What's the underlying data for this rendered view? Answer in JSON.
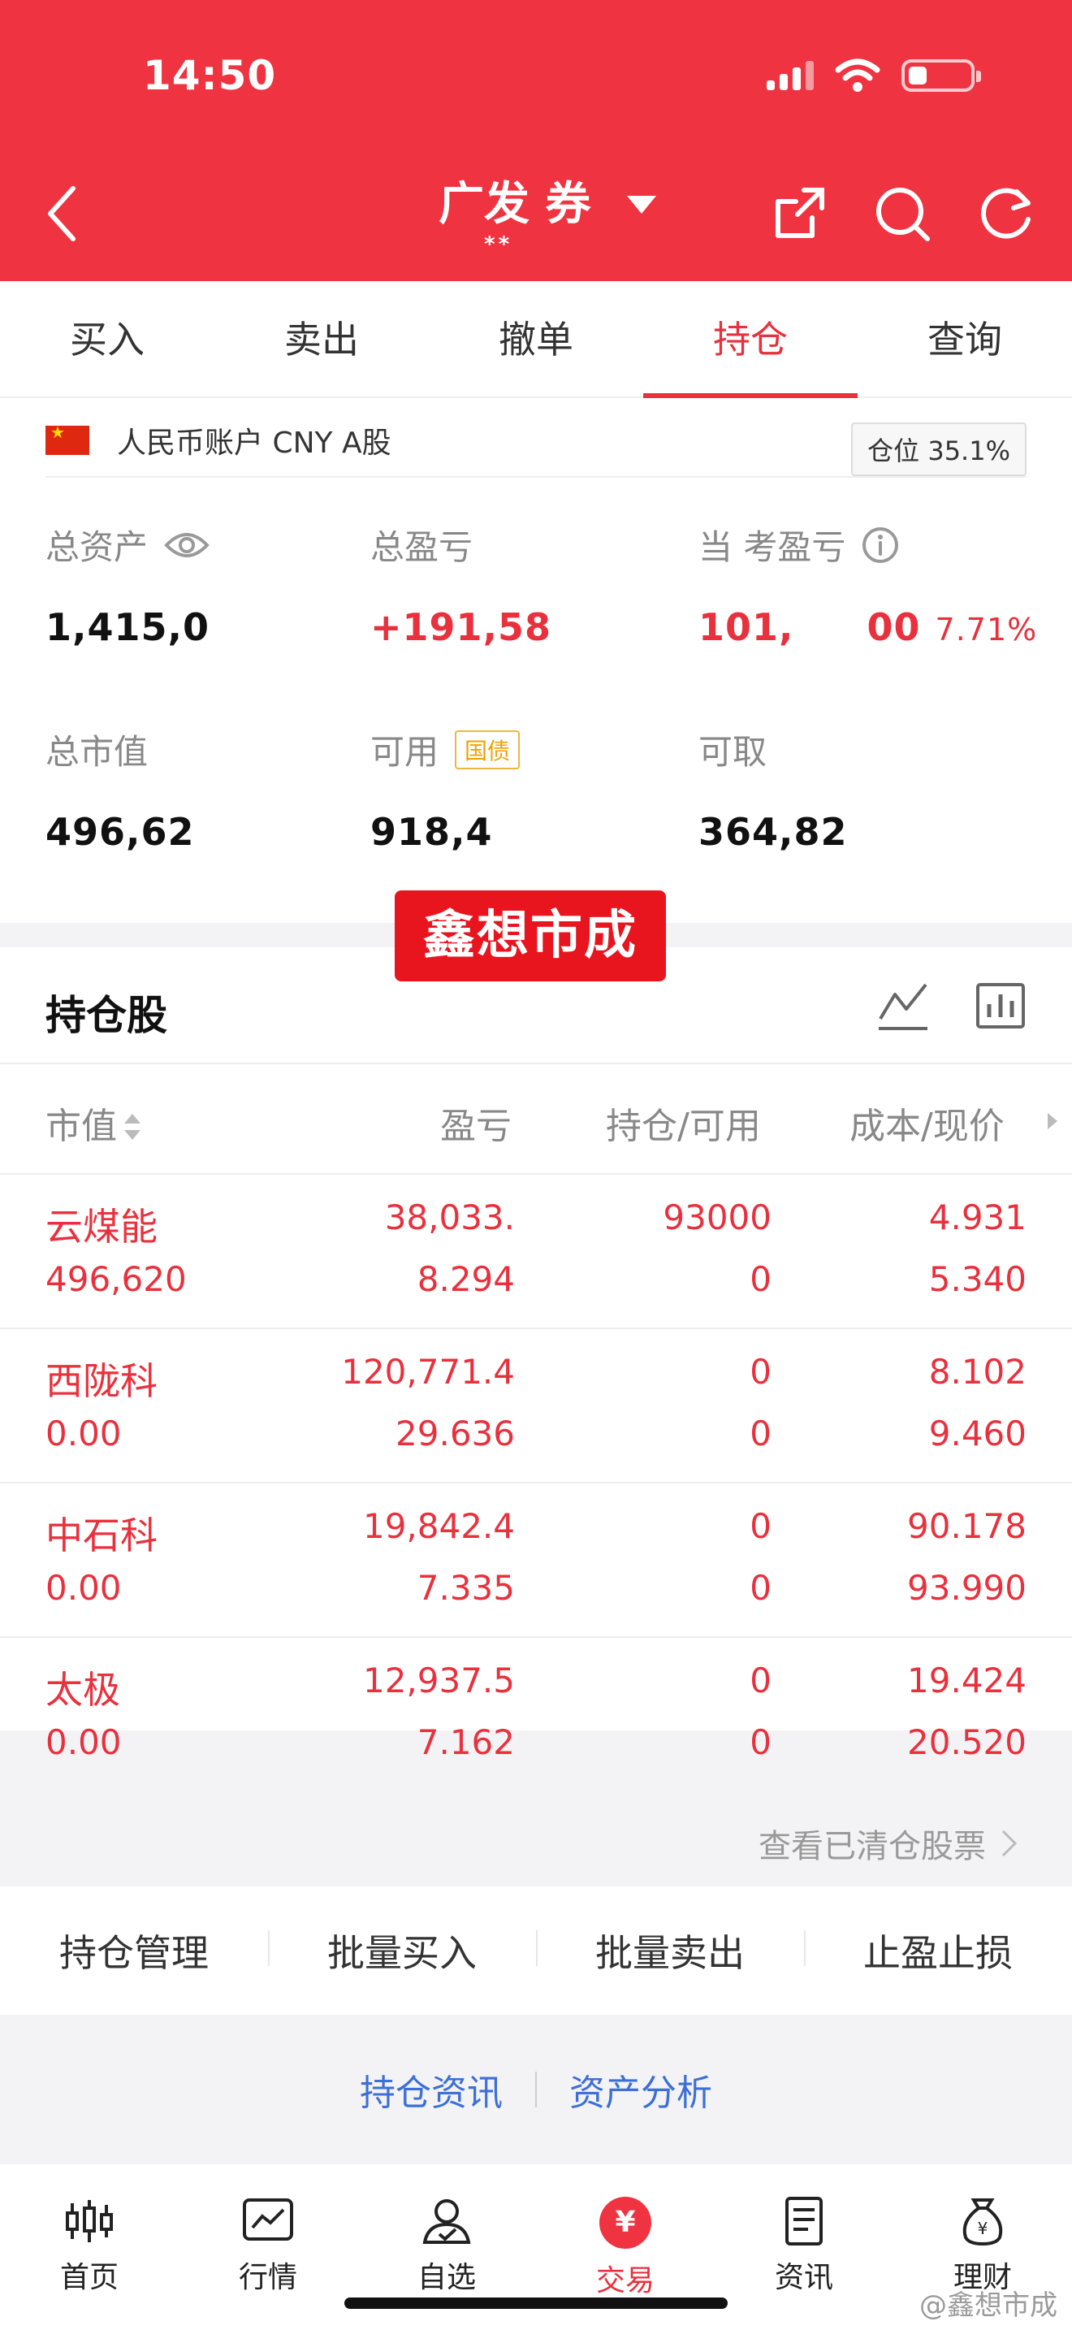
{
  "status": {
    "time": "14:50"
  },
  "nav": {
    "title": "广发 券",
    "subtitle": "**"
  },
  "tabs": [
    "买入",
    "卖出",
    "撤单",
    "持仓",
    "查询"
  ],
  "account": {
    "currency_label": "人民币账户 CNY A股",
    "position_ratio": "仓位 35.1%",
    "total_assets_label": "总资产",
    "total_assets": "1,415,0",
    "total_pl_label": "总盈亏",
    "total_pl": "+191,58",
    "daily_pl_label": "当 考盈亏",
    "daily_pl": "101,",
    "daily_pl_tail": "00",
    "daily_pl_pct": "7.71%",
    "market_value_label": "总市值",
    "market_value": "496,62",
    "available_label": "可用",
    "available_tag": "国债",
    "available": "918,4",
    "withdrawable_label": "可取",
    "withdrawable": "364,82"
  },
  "watermark_badge": "鑫想市成",
  "holdings": {
    "title": "持仓股",
    "columns": [
      "市值",
      "盈亏",
      "持仓/可用",
      "成本/现价"
    ],
    "rows": [
      {
        "name": "云煤能",
        "value": "496,620",
        "pl": "38,033.",
        "pl_pct": "8.294",
        "hold": "93000",
        "avail": "0",
        "cost": "4.931",
        "price": "5.340"
      },
      {
        "name": "西陇科",
        "value": "0.00",
        "pl": "120,771.4",
        "pl_pct": "29.636",
        "hold": "0",
        "avail": "0",
        "cost": "8.102",
        "price": "9.460"
      },
      {
        "name": "中石科",
        "value": "0.00",
        "pl": "19,842.4",
        "pl_pct": "7.335",
        "hold": "0",
        "avail": "0",
        "cost": "90.178",
        "price": "93.990"
      },
      {
        "name": "太极",
        "value": "0.00",
        "pl": "12,937.5",
        "pl_pct": "7.162",
        "hold": "0",
        "avail": "0",
        "cost": "19.424",
        "price": "20.520"
      }
    ]
  },
  "more_link": "查看已清仓股票",
  "actions": [
    "持仓管理",
    "批量买入",
    "批量卖出",
    "止盈止损"
  ],
  "links": [
    "持仓资讯",
    "资产分析"
  ],
  "bottom_nav": [
    "首页",
    "行情",
    "自选",
    "交易",
    "资讯",
    "理财"
  ],
  "corner_mark": "@鑫想市成"
}
